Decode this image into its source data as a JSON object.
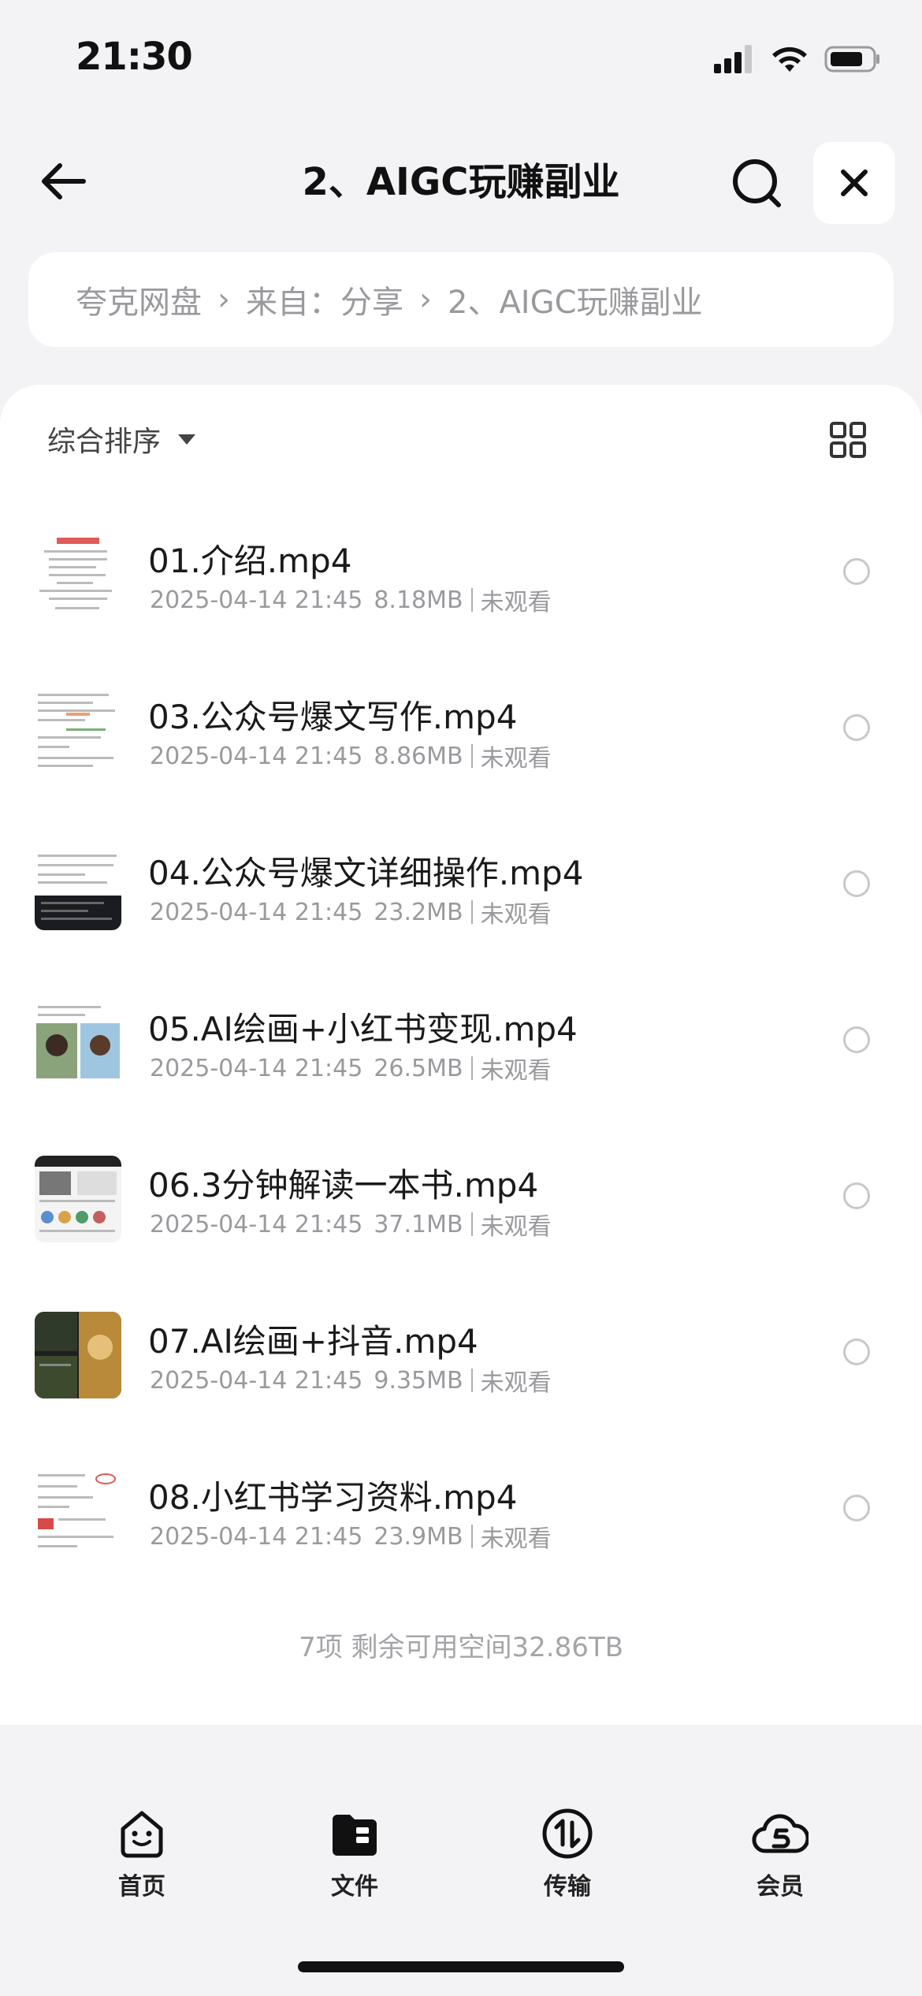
{
  "status_bar": {
    "time": "21:30"
  },
  "header": {
    "title": "2、AIGC玩赚副业"
  },
  "breadcrumb": [
    "夸克网盘",
    "来自：分享",
    "2、AIGC玩赚副业"
  ],
  "toolbar": {
    "sort_label": "综合排序"
  },
  "files": [
    {
      "name": "01.介绍.mp4",
      "date": "2025-04-14 21:45",
      "size": "8.18MB",
      "status": "未观看"
    },
    {
      "name": "03.公众号爆文写作.mp4",
      "date": "2025-04-14 21:45",
      "size": "8.86MB",
      "status": "未观看"
    },
    {
      "name": "04.公众号爆文详细操作.mp4",
      "date": "2025-04-14 21:45",
      "size": "23.2MB",
      "status": "未观看"
    },
    {
      "name": "05.AI绘画+小红书变现.mp4",
      "date": "2025-04-14 21:45",
      "size": "26.5MB",
      "status": "未观看"
    },
    {
      "name": "06.3分钟解读一本书.mp4",
      "date": "2025-04-14 21:45",
      "size": "37.1MB",
      "status": "未观看"
    },
    {
      "name": "07.AI绘画+抖音.mp4",
      "date": "2025-04-14 21:45",
      "size": "9.35MB",
      "status": "未观看"
    },
    {
      "name": "08.小红书学习资料.mp4",
      "date": "2025-04-14 21:45",
      "size": "23.9MB",
      "status": "未观看"
    }
  ],
  "summary": "7项 剩余可用空间32.86TB",
  "tabbar": [
    {
      "label": "首页",
      "icon": "smile-face-icon"
    },
    {
      "label": "文件",
      "icon": "folder-icon"
    },
    {
      "label": "传输",
      "icon": "transfer-icon"
    },
    {
      "label": "会员",
      "icon": "cloud-member-icon"
    }
  ]
}
